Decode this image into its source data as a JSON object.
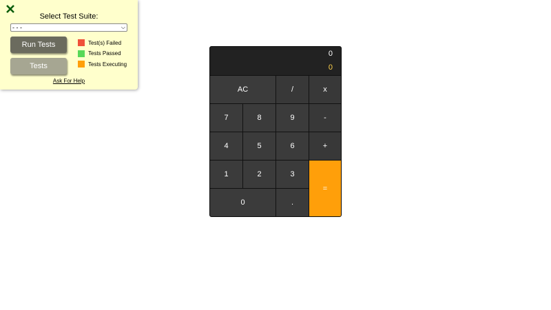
{
  "panel": {
    "suite_label": "Select Test Suite:",
    "suite_selected": "- - -",
    "run_button": "Run Tests",
    "tests_button": "Tests",
    "legend": [
      {
        "label": "Test(s) Failed",
        "color": "#f0503a"
      },
      {
        "label": "Tests Passed",
        "color": "#58d858"
      },
      {
        "label": "Tests Executing",
        "color": "#ff9f0a"
      }
    ],
    "help_link": "Ask For Help",
    "close_color": "#0a5c0a"
  },
  "calculator": {
    "formula": "0",
    "output": "0",
    "keys": {
      "clear": "AC",
      "divide": "/",
      "multiply": "x",
      "seven": "7",
      "eight": "8",
      "nine": "9",
      "subtract": "-",
      "four": "4",
      "five": "5",
      "six": "6",
      "add": "+",
      "one": "1",
      "two": "2",
      "three": "3",
      "equals": "=",
      "zero": "0",
      "decimal": "."
    }
  }
}
